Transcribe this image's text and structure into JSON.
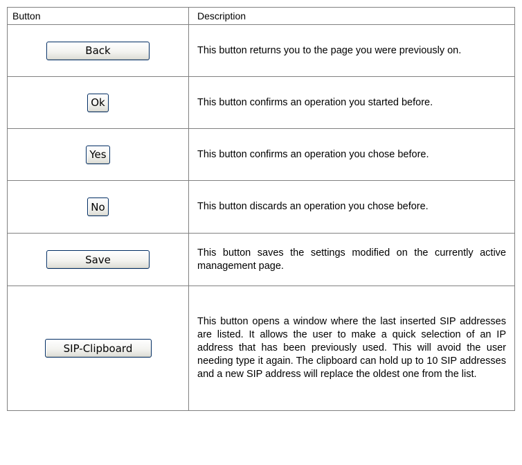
{
  "table": {
    "headers": {
      "button": "Button",
      "description": "Description"
    },
    "rows": [
      {
        "button_label": "Back",
        "description": "This button returns you to the page you were previously on."
      },
      {
        "button_label": "Ok",
        "description": "This button confirms an operation you started before."
      },
      {
        "button_label": "Yes",
        "description": "This button confirms an operation you chose before."
      },
      {
        "button_label": "No",
        "description": "This button discards an operation you chose before."
      },
      {
        "button_label": "Save",
        "description": "This button saves the settings modified on the currently active management page."
      },
      {
        "button_label": "SIP-Clipboard",
        "description": "This button opens a window where the last inserted SIP addresses are listed. It allows the user to make a quick selection of an IP address that has been previously used. This will avoid the user needing type it again. The clipboard can hold up to 10 SIP addresses and a new SIP address will replace the oldest one from the list."
      }
    ]
  }
}
